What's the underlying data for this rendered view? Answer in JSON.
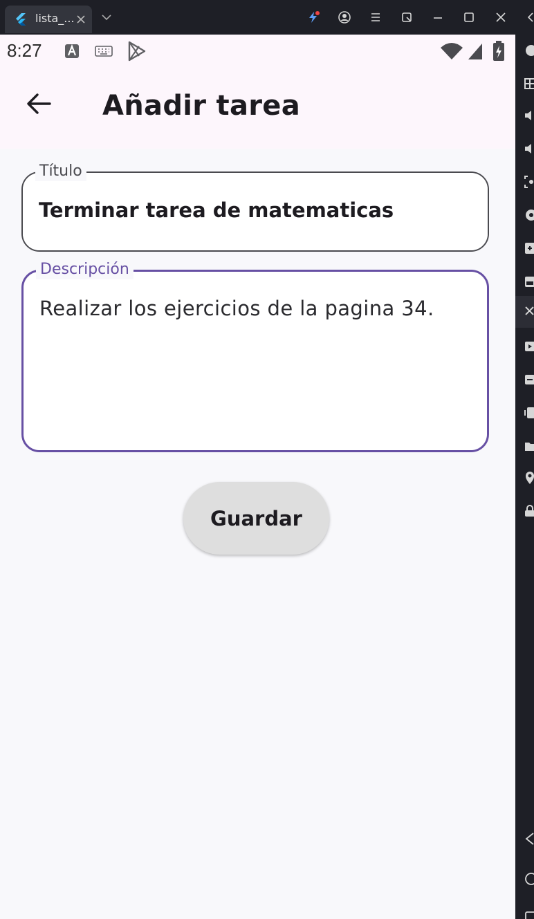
{
  "window": {
    "tab_title": "lista_..."
  },
  "status_bar": {
    "time": "8:27"
  },
  "app_bar": {
    "title": "Añadir tarea"
  },
  "form": {
    "title_field": {
      "label": "Título",
      "value": "Terminar tarea de matematicas"
    },
    "description_field": {
      "label": "Descripción",
      "value": "Realizar los ejercicios de la pagina 34."
    },
    "save_label": "Guardar"
  },
  "colors": {
    "accent": "#6750a4",
    "app_bar_bg": "#fdf6fc",
    "page_bg": "#f8f8fb",
    "button_bg": "#dedede"
  }
}
